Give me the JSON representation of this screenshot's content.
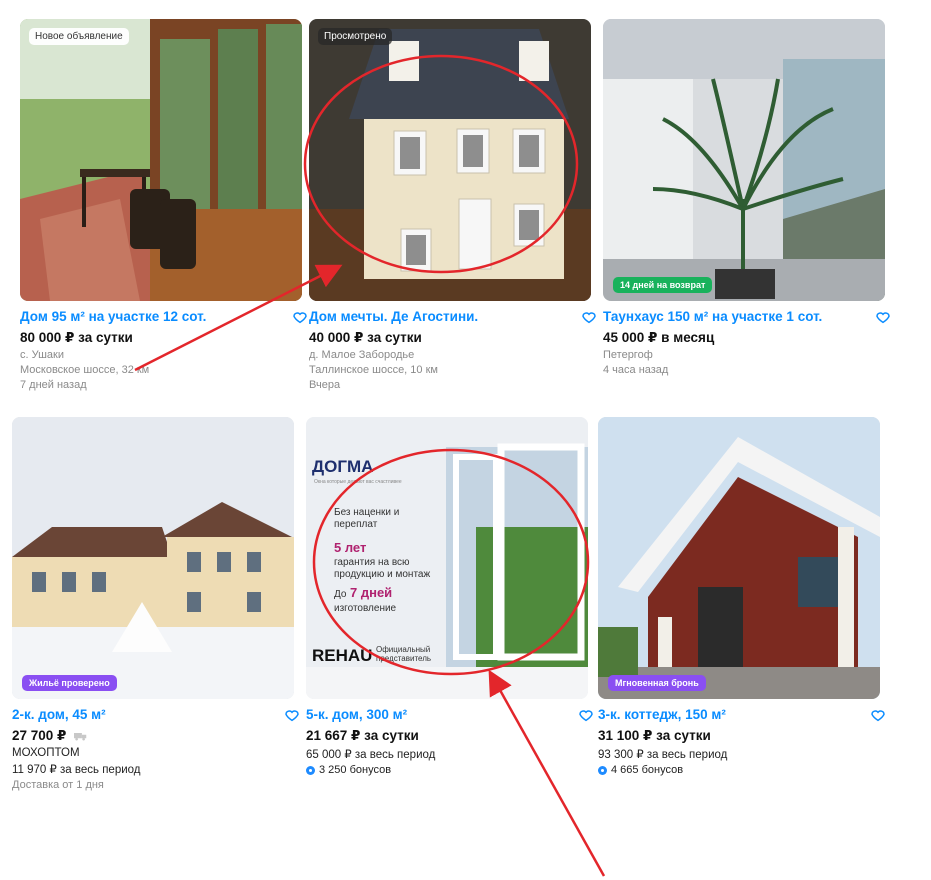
{
  "listings": [
    {
      "badge_top": "Новое объявление",
      "title": "Дом 95 м² на участке 12 сот.",
      "price": "80 000 ₽ за сутки",
      "location": "с. Ушаки",
      "highway": "Московское шоссе, 32 км",
      "posted": "7 дней назад"
    },
    {
      "badge_top": "Просмотрено",
      "title": "Дом мечты. Де Агостини.",
      "price": "40 000 ₽ за сутки",
      "location": "д. Малое Забородье",
      "highway": "Таллинское шоссе, 10 км",
      "posted": "Вчера"
    },
    {
      "badge_bottom": "14 дней на возврат",
      "title": "Таунхаус 150 м² на участке 1 сот.",
      "price": "45 000 ₽ в месяц",
      "location": "Петергоф",
      "posted": "4 часа назад"
    },
    {
      "badge_bottom": "Жильё проверено",
      "title": "2-к. дом, 45 м²",
      "price": "27 700 ₽",
      "seller": "МОХОПТОМ",
      "total": "11 970 ₽ за весь период",
      "delivery": "Доставка от 1 дня"
    },
    {
      "title": "5-к. дом, 300 м²",
      "price": "21 667 ₽ за сутки",
      "total": "65 000 ₽ за весь период",
      "bonus": "3 250 бонусов",
      "ad": {
        "brand": "ДОГМА",
        "tagline": "Окна которые делают вас счастливее",
        "item1": "Без наценки и переплат",
        "item2_big": "5 лет",
        "item2": "гарантия на всю продукцию и монтаж",
        "item3_prefix": "До",
        "item3_big": "7 дней",
        "item3": "изготовление",
        "partner": "REHAU",
        "partner_note": "Официальный представитель"
      }
    },
    {
      "badge_bottom": "Мгновенная бронь",
      "title": "3-к. коттедж, 150 м²",
      "price": "31 100 ₽ за сутки",
      "total": "93 300 ₽ за весь период",
      "bonus": "4 665 бонусов"
    }
  ],
  "colors": {
    "link": "#0a8cff",
    "annotation": "#e3262b",
    "badge_green": "#19b25c",
    "badge_purple": "#8a4ff2"
  }
}
